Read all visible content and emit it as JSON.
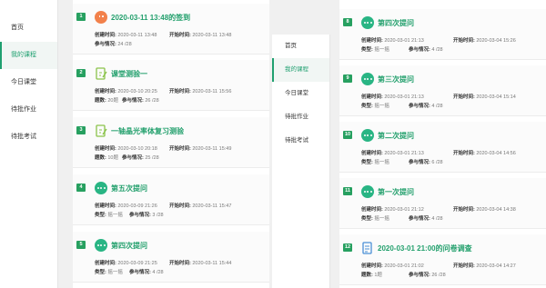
{
  "left_nav": {
    "items": [
      {
        "label": "首页",
        "active": false
      },
      {
        "label": "我的课程",
        "active": true
      },
      {
        "label": "今日课堂",
        "active": false
      },
      {
        "label": "待批作业",
        "active": false
      },
      {
        "label": "待批考试",
        "active": false
      }
    ]
  },
  "mid_nav": {
    "items": [
      {
        "label": "首页",
        "active": false
      },
      {
        "label": "我的课程",
        "active": true
      },
      {
        "label": "今日课堂",
        "active": false
      },
      {
        "label": "待批作业",
        "active": false
      },
      {
        "label": "待批考试",
        "active": false
      }
    ]
  },
  "labels": {
    "created": "创建时间:",
    "started": "开始时间:",
    "type": "类型:",
    "questions": "题数:",
    "participation": "参与情况:"
  },
  "left_cards": [
    {
      "num": "1",
      "icon": "sign-in-icon",
      "title": "2020-03-11 13:48的签到",
      "created": "2020-03-11 13:48",
      "started": "2020-03-11 13:48",
      "row2_label": "参与情况:",
      "row2_value": "24 /28",
      "part": ""
    },
    {
      "num": "2",
      "icon": "quiz-icon",
      "title": "课堂测验一",
      "created": "2020-03-10 20:25",
      "started": "2020-03-11 15:56",
      "row2_label": "题数:",
      "row2_value": "20题",
      "part": "26 /28"
    },
    {
      "num": "3",
      "icon": "quiz-icon",
      "title": "一轴晶光率体复习测验",
      "created": "2020-03-10 20:18",
      "started": "2020-03-11 15:49",
      "row2_label": "题数:",
      "row2_value": "10题",
      "part": "25 /28"
    },
    {
      "num": "4",
      "icon": "discussion-icon",
      "title": "第五次提问",
      "created": "2020-03-09 21:26",
      "started": "2020-03-11 15:47",
      "row2_label": "类型:",
      "row2_value": "摇一摇",
      "part": "3 /28"
    },
    {
      "num": "5",
      "icon": "discussion-icon",
      "title": "第四次提问",
      "created": "2020-03-09 21:25",
      "started": "2020-03-11 15:44",
      "row2_label": "类型:",
      "row2_value": "摇一摇",
      "part": "4 /28"
    }
  ],
  "right_cards": [
    {
      "num": "8",
      "icon": "discussion-icon",
      "title": "第四次提问",
      "created": "2020-03-01 21:13",
      "started": "2020-03-04 15:26",
      "row2_label": "类型:",
      "row2_value": "摇一摇",
      "part": "4 /28"
    },
    {
      "num": "9",
      "icon": "discussion-icon",
      "title": "第三次提问",
      "created": "2020-03-01 21:13",
      "started": "2020-03-04 15:14",
      "row2_label": "类型:",
      "row2_value": "摇一摇",
      "part": "4 /28"
    },
    {
      "num": "10",
      "icon": "discussion-icon",
      "title": "第二次提问",
      "created": "2020-03-01 21:13",
      "started": "2020-03-04 14:56",
      "row2_label": "类型:",
      "row2_value": "摇一摇",
      "part": "6 /28"
    },
    {
      "num": "11",
      "icon": "discussion-icon",
      "title": "第一次提问",
      "created": "2020-03-01 21:12",
      "started": "2020-03-04 14:38",
      "row2_label": "类型:",
      "row2_value": "摇一摇",
      "part": "4 /28"
    },
    {
      "num": "12",
      "icon": "questionnaire-icon",
      "title": "2020-03-01 21:00的问卷调查",
      "created": "2020-03-01 21:02",
      "started": "2020-03-04 14:27",
      "row2_label": "题数:",
      "row2_value": "1题",
      "part": "26 /28"
    }
  ],
  "colors": {
    "accent": "#23a06d",
    "badge": "#27a060",
    "orange": "#f2814b"
  }
}
